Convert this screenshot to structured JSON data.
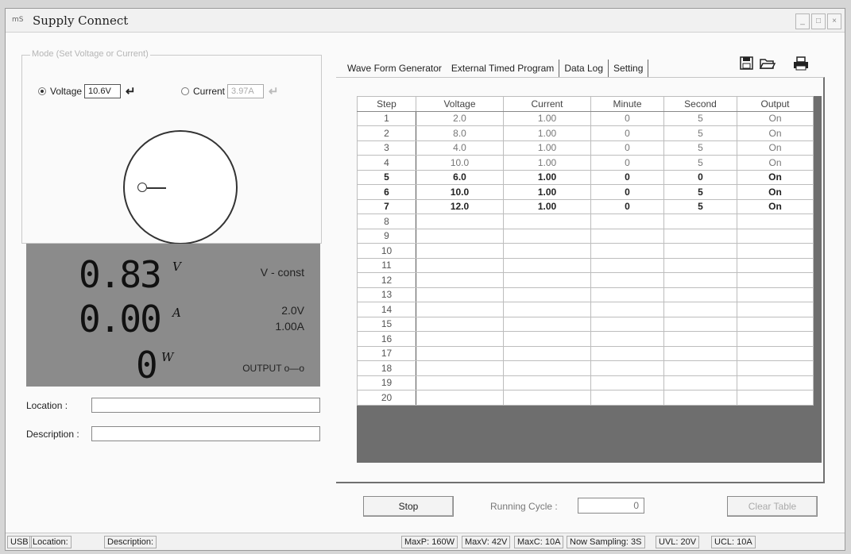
{
  "window": {
    "title": "Supply Connect",
    "icon_label": "mS",
    "buttons": [
      "_",
      "□",
      "×"
    ]
  },
  "mode": {
    "legend": "Mode (Set Voltage or Current)",
    "voltage_label": "Voltage",
    "voltage_value": "10.6V",
    "current_label": "Current",
    "current_value": "3.97A",
    "selected": "voltage"
  },
  "display": {
    "voltage_digits": "0.83",
    "voltage_unit": "V",
    "current_digits": "0.00",
    "current_unit": "A",
    "power_digits": "0",
    "power_unit": "W",
    "mode_text": "V - const",
    "set_voltage": "2.0V",
    "set_current": "1.00A",
    "output_text": "OUTPUT o—o"
  },
  "location": {
    "label": "Location :",
    "value": ""
  },
  "description": {
    "label": "Description :",
    "value": ""
  },
  "tabs": [
    {
      "label": "Wave Form Generator"
    },
    {
      "label": "External Timed Program"
    },
    {
      "label": "Data Log"
    },
    {
      "label": "Setting"
    }
  ],
  "toolbar_icons": [
    "save-icon",
    "open-folder-icon",
    "print-icon"
  ],
  "table": {
    "columns": [
      "Step",
      "Voltage",
      "Current",
      "Minute",
      "Second",
      "Output"
    ],
    "rows": [
      [
        "1",
        "2.0",
        "1.00",
        "0",
        "5",
        "On"
      ],
      [
        "2",
        "8.0",
        "1.00",
        "0",
        "5",
        "On"
      ],
      [
        "3",
        "4.0",
        "1.00",
        "0",
        "5",
        "On"
      ],
      [
        "4",
        "10.0",
        "1.00",
        "0",
        "5",
        "On"
      ],
      [
        "5",
        "6.0",
        "1.00",
        "0",
        "0",
        "On"
      ],
      [
        "6",
        "10.0",
        "1.00",
        "0",
        "5",
        "On"
      ],
      [
        "7",
        "12.0",
        "1.00",
        "0",
        "5",
        "On"
      ],
      [
        "8",
        "",
        "",
        "",
        "",
        ""
      ],
      [
        "9",
        "",
        "",
        "",
        "",
        ""
      ],
      [
        "10",
        "",
        "",
        "",
        "",
        ""
      ],
      [
        "11",
        "",
        "",
        "",
        "",
        ""
      ],
      [
        "12",
        "",
        "",
        "",
        "",
        ""
      ],
      [
        "13",
        "",
        "",
        "",
        "",
        ""
      ],
      [
        "14",
        "",
        "",
        "",
        "",
        ""
      ],
      [
        "15",
        "",
        "",
        "",
        "",
        ""
      ],
      [
        "16",
        "",
        "",
        "",
        "",
        ""
      ],
      [
        "17",
        "",
        "",
        "",
        "",
        ""
      ],
      [
        "18",
        "",
        "",
        "",
        "",
        ""
      ],
      [
        "19",
        "",
        "",
        "",
        "",
        ""
      ],
      [
        "20",
        "",
        "",
        "",
        "",
        ""
      ]
    ]
  },
  "controls": {
    "stop_label": "Stop",
    "running_cycle_label": "Running Cycle :",
    "running_cycle_value": "0",
    "clear_table_label": "Clear Table"
  },
  "status": {
    "usb": "USB",
    "location": "Location:",
    "description": "Description:",
    "maxp": "MaxP: 160W",
    "maxv": "MaxV: 42V",
    "maxc": "MaxC: 10A",
    "sampling": "Now Sampling: 3S",
    "uvl": "UVL: 20V",
    "ucl": "UCL: 10A"
  }
}
